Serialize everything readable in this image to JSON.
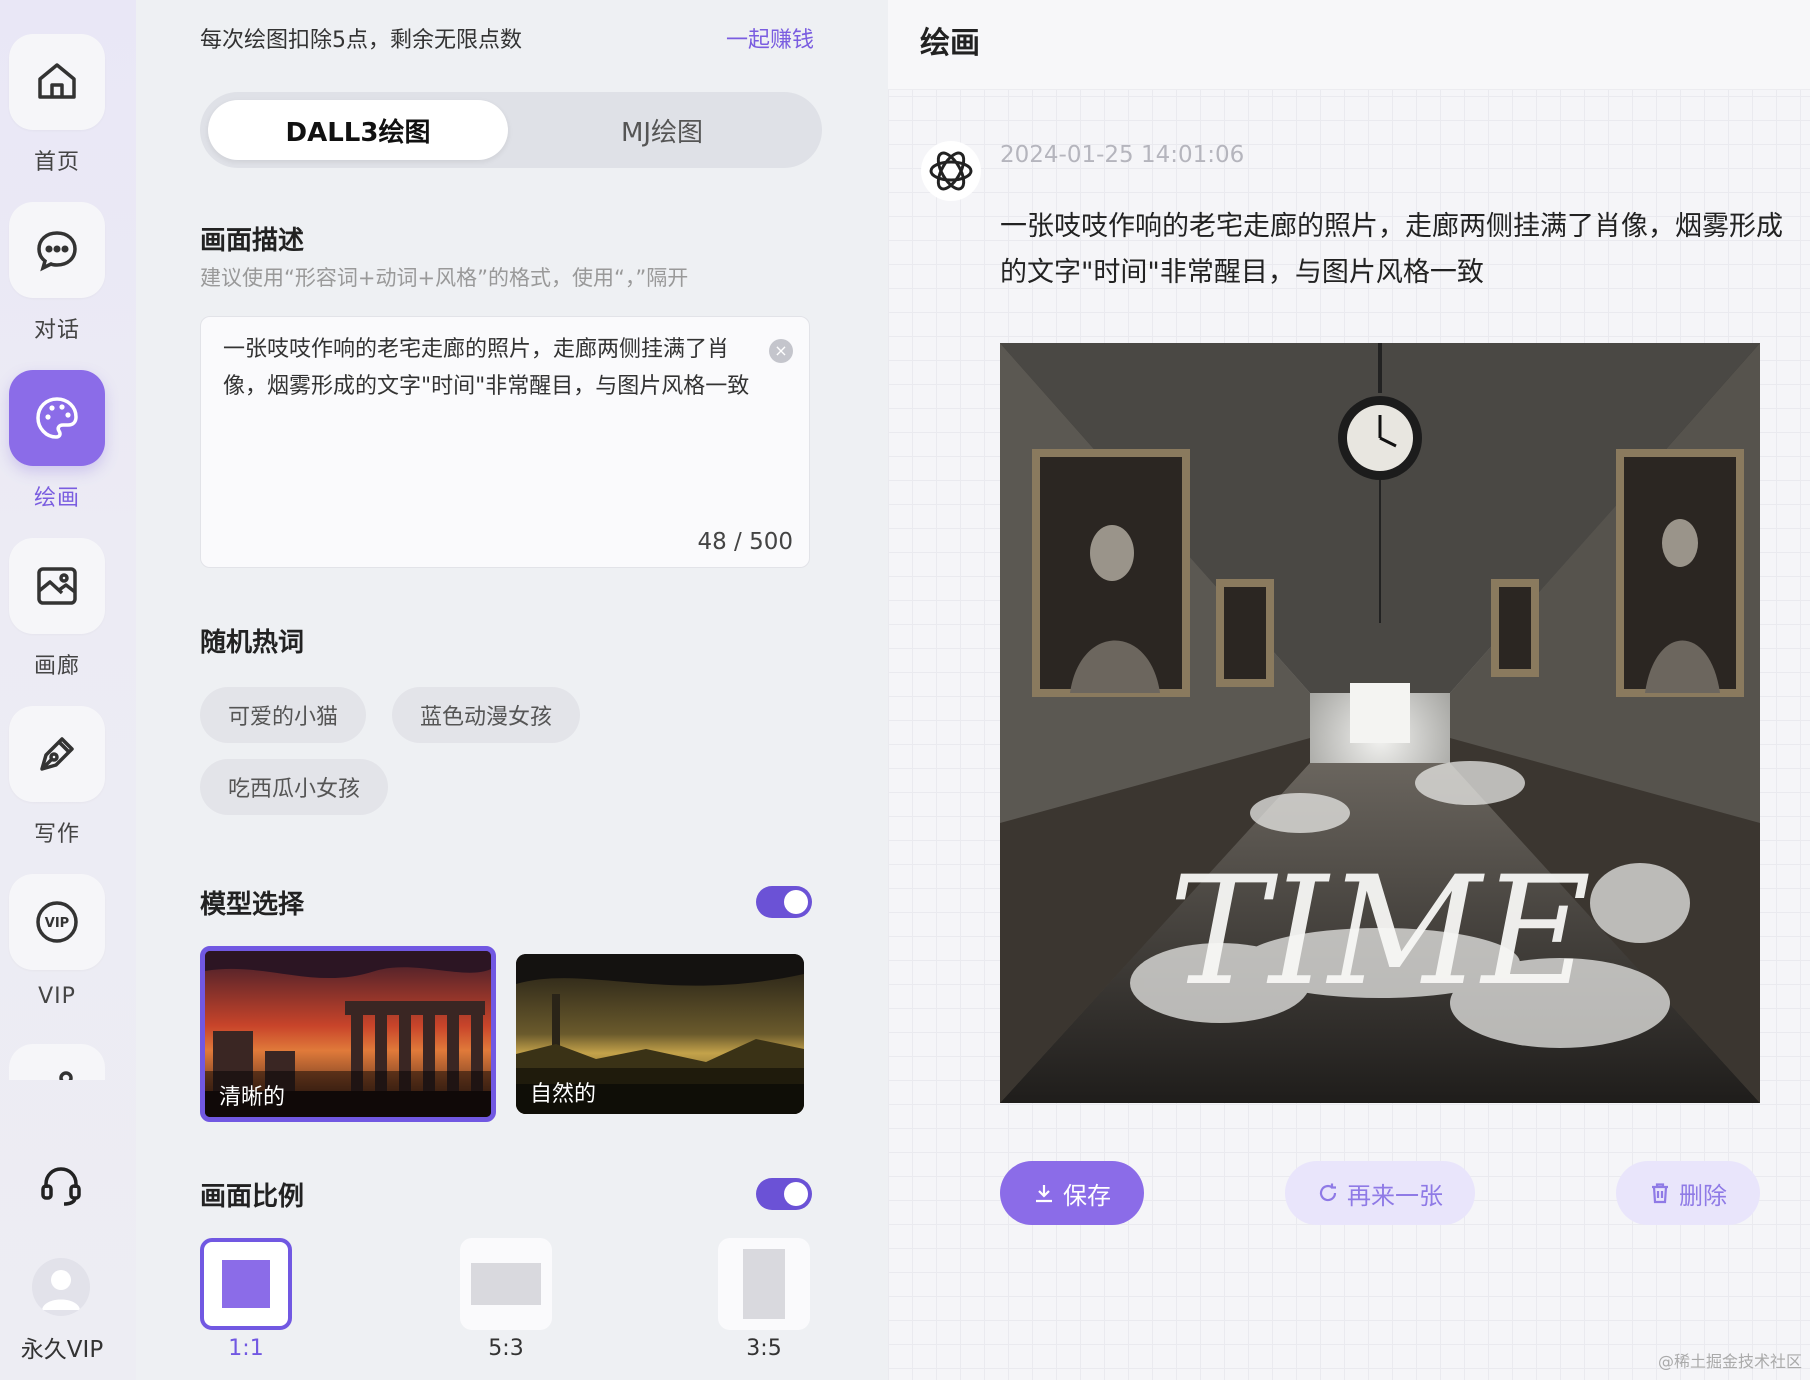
{
  "sidebar": {
    "items": [
      {
        "label": "首页",
        "icon": "home-icon"
      },
      {
        "label": "对话",
        "icon": "chat-icon"
      },
      {
        "label": "绘画",
        "icon": "palette-icon"
      },
      {
        "label": "画廊",
        "icon": "gallery-icon"
      },
      {
        "label": "写作",
        "icon": "pen-icon"
      },
      {
        "label": "VIP",
        "icon": "vip-icon"
      }
    ],
    "active": "绘画",
    "user_label": "永久VIP"
  },
  "form": {
    "points_note": "每次绘图扣除5点，剩余无限点数",
    "earn_link": "一起赚钱",
    "tabs": [
      "DALL3绘图",
      "MJ绘图"
    ],
    "prompt_title": "画面描述",
    "prompt_hint": "建议使用“形容词+动词+风格”的格式，使用“，”隔开",
    "prompt_value": "一张吱吱作响的老宅走廊的照片，走廊两侧挂满了肖像，烟雾形成的文字\"时间\"非常醒目，与图片风格一致",
    "prompt_counter": "48 / 500",
    "hotwords_title": "随机热词",
    "hotwords": [
      "可爱的小猫",
      "蓝色动漫女孩",
      "吃西瓜小女孩"
    ],
    "model_title": "模型选择",
    "models": [
      "清晰的",
      "自然的"
    ],
    "ratio_title": "画面比例",
    "ratios": [
      "1:1",
      "5:3",
      "3:5"
    ]
  },
  "result": {
    "title": "绘画",
    "timestamp": "2024-01-25 14:01:06",
    "message": "一张吱吱作响的老宅走廊的照片，走廊两侧挂满了肖像，烟雾形成的文字\"时间\"非常醒目，与图片风格一致",
    "image_text": "TIME",
    "actions": {
      "save": "保存",
      "again": "再来一张",
      "delete": "删除"
    }
  },
  "colors": {
    "accent": "#7158e2",
    "accent_soft": "#e9e5fb"
  },
  "watermark": "@稀土掘金技术社区"
}
